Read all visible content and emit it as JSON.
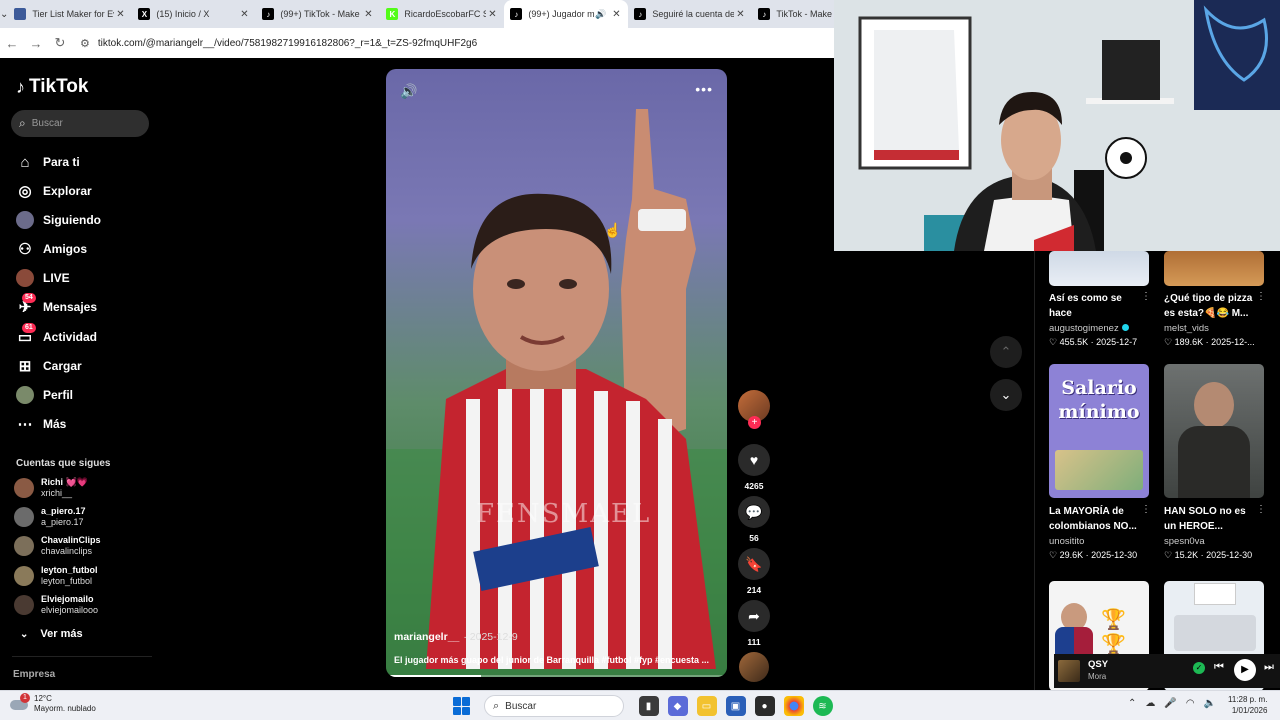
{
  "browser": {
    "tabs": [
      {
        "title": "Tier List Maker for Ev",
        "color": "#3c5a99",
        "letter": "",
        "active": false
      },
      {
        "title": "(15) Inicio / X",
        "color": "#000000",
        "letter": "X",
        "active": false
      },
      {
        "title": "(99+) TikTok - Make Yo",
        "color": "#000000",
        "letter": "♪",
        "active": false
      },
      {
        "title": "RicardoEscobarFC Str",
        "color": "#53fc18",
        "letter": "K",
        "active": false
      },
      {
        "title": "(99+) Jugador má",
        "color": "#000000",
        "letter": "♪",
        "active": true
      },
      {
        "title": "Seguiré la cuenta de",
        "color": "#000000",
        "letter": "♪",
        "active": false
      },
      {
        "title": "TikTok - Make",
        "color": "#000000",
        "letter": "♪",
        "active": false
      }
    ],
    "url": "tiktok.com/@mariangelr__/video/7581982719916182806?_r=1&_t=ZS-92fmqUHF2g6"
  },
  "sidebar": {
    "brand": "TikTok",
    "search_placeholder": "Buscar",
    "nav": [
      {
        "label": "Para ti",
        "icon": "home-icon",
        "glyph": "⌂",
        "badge": ""
      },
      {
        "label": "Explorar",
        "icon": "compass-icon",
        "glyph": "◎",
        "badge": ""
      },
      {
        "label": "Siguiendo",
        "icon": "following-icon",
        "glyph": "",
        "badge": ""
      },
      {
        "label": "Amigos",
        "icon": "friends-icon",
        "glyph": "⚇",
        "badge": ""
      },
      {
        "label": "LIVE",
        "icon": "live-icon",
        "glyph": "",
        "badge": ""
      },
      {
        "label": "Mensajes",
        "icon": "messages-icon",
        "glyph": "✈",
        "badge": "54"
      },
      {
        "label": "Actividad",
        "icon": "activity-icon",
        "glyph": "▭",
        "badge": "61"
      },
      {
        "label": "Cargar",
        "icon": "upload-icon",
        "glyph": "⊞",
        "badge": ""
      },
      {
        "label": "Perfil",
        "icon": "profile-icon",
        "glyph": "",
        "badge": ""
      },
      {
        "label": "Más",
        "icon": "more-icon",
        "glyph": "⋯",
        "badge": ""
      }
    ],
    "following_title": "Cuentas que sigues",
    "following": [
      {
        "name": "Richi 💓💗",
        "handle": "xrichi__",
        "color": "#8a5a44"
      },
      {
        "name": "a_piero.17",
        "handle": "a_piero.17",
        "color": "#6b6b6b"
      },
      {
        "name": "ChavalinClips",
        "handle": "chavalinclips",
        "color": "#7c6f5a"
      },
      {
        "name": "leyton_futbol",
        "handle": "leyton_futbol",
        "color": "#8a7a5a"
      },
      {
        "name": "Elviejomailo",
        "handle": "elviejomailooo",
        "color": "#4a3a32"
      }
    ],
    "see_more": "Ver más",
    "footer": "Empresa"
  },
  "video": {
    "author": "mariangelr__",
    "date": "· 2025-12-9",
    "caption": "El jugador más guapo del junior de Barranquilla #futbol #fyp #encuesta ...",
    "progress": 0.28,
    "actions": {
      "likes": "4265",
      "comments": "56",
      "saves": "214",
      "shares": "111"
    }
  },
  "recommendations": [
    {
      "title": "Así es como se hace",
      "user": "augustogimenez",
      "verified": true,
      "likes": "455.5K",
      "date": "2025-12-7"
    },
    {
      "title": "¿Qué tipo de pizza es esta?🍕😂 M...",
      "user": "melst_vids",
      "verified": false,
      "likes": "189.6K",
      "date": "2025-12-..."
    },
    {
      "title": "La MAYORÍA de colombianos NO...",
      "user": "unositito",
      "verified": false,
      "likes": "29.6K",
      "date": "2025-12-30",
      "thumb_text": "Salario mínimo"
    },
    {
      "title": "HAN SOLO no es un HEROE...",
      "user": "spesn0va",
      "verified": false,
      "likes": "15.2K",
      "date": "2025-12-30"
    }
  ],
  "player": {
    "song": "QSY",
    "artist": "Mora"
  },
  "taskbar": {
    "temp": "12°C",
    "weather": "Mayorm. nublado",
    "weather_badge": "1",
    "search": "Buscar",
    "time": "11:28 p. m.",
    "date": "1/01/2026"
  }
}
